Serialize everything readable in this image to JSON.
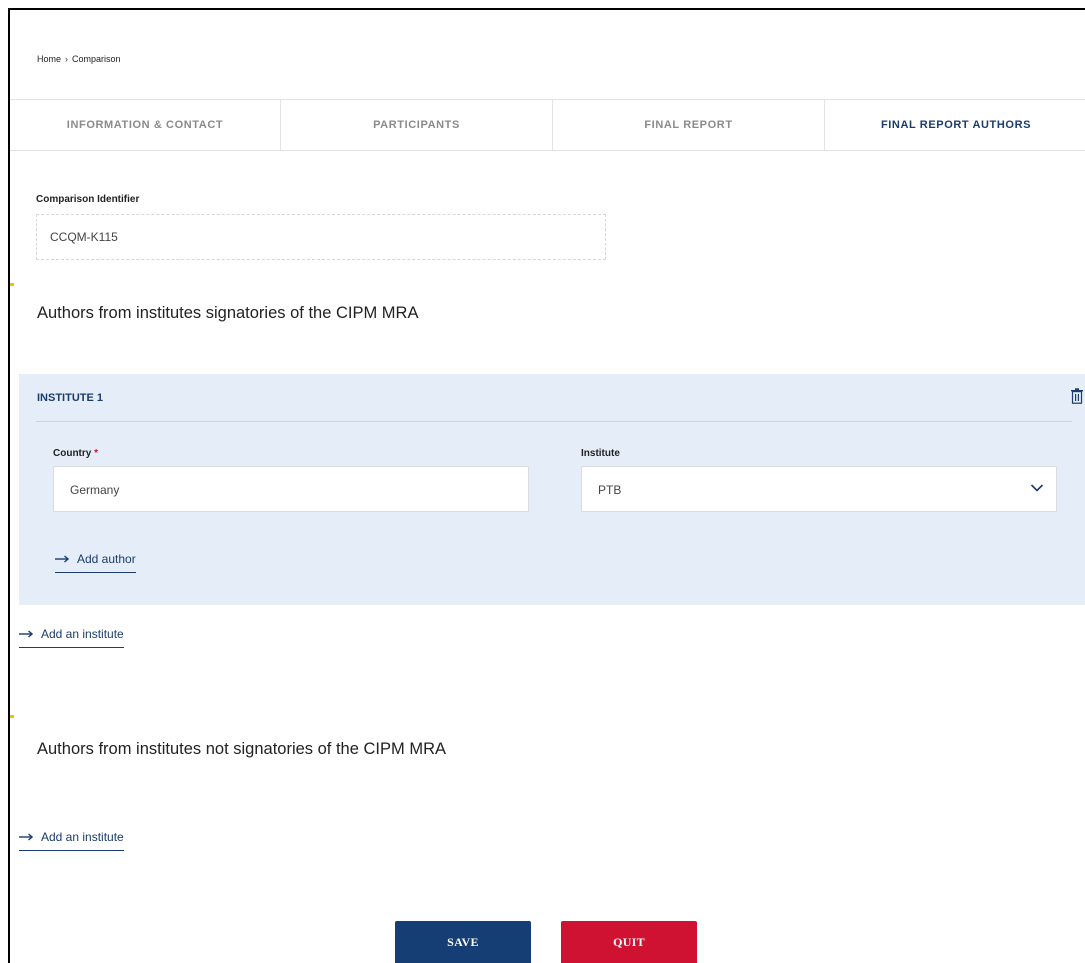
{
  "breadcrumb": {
    "home": "Home",
    "separator": "›",
    "current": "Comparison"
  },
  "tabs": [
    {
      "label": "INFORMATION & CONTACT",
      "active": false
    },
    {
      "label": "PARTICIPANTS",
      "active": false
    },
    {
      "label": "FINAL REPORT",
      "active": false
    },
    {
      "label": "FINAL REPORT AUTHORS",
      "active": true
    }
  ],
  "identifier": {
    "label": "Comparison Identifier",
    "value": "CCQM-K115"
  },
  "signatories": {
    "title": "Authors from institutes signatories of the CIPM MRA",
    "institute": {
      "title": "INSTITUTE 1",
      "country_label": "Country",
      "required_marker": "*",
      "country_value": "Germany",
      "institute_label": "Institute",
      "institute_value": "PTB",
      "add_author": "Add author"
    },
    "add_institute": "Add an institute"
  },
  "non_signatories": {
    "title": "Authors from institutes not signatories of the CIPM MRA",
    "add_institute": "Add an institute"
  },
  "actions": {
    "save": "SAVE",
    "quit": "QUIT"
  },
  "colors": {
    "accent": "#1a3c6e",
    "panel": "#e5eef8",
    "save": "#153e75",
    "quit": "#cf1232",
    "marker": "#f2c200"
  }
}
